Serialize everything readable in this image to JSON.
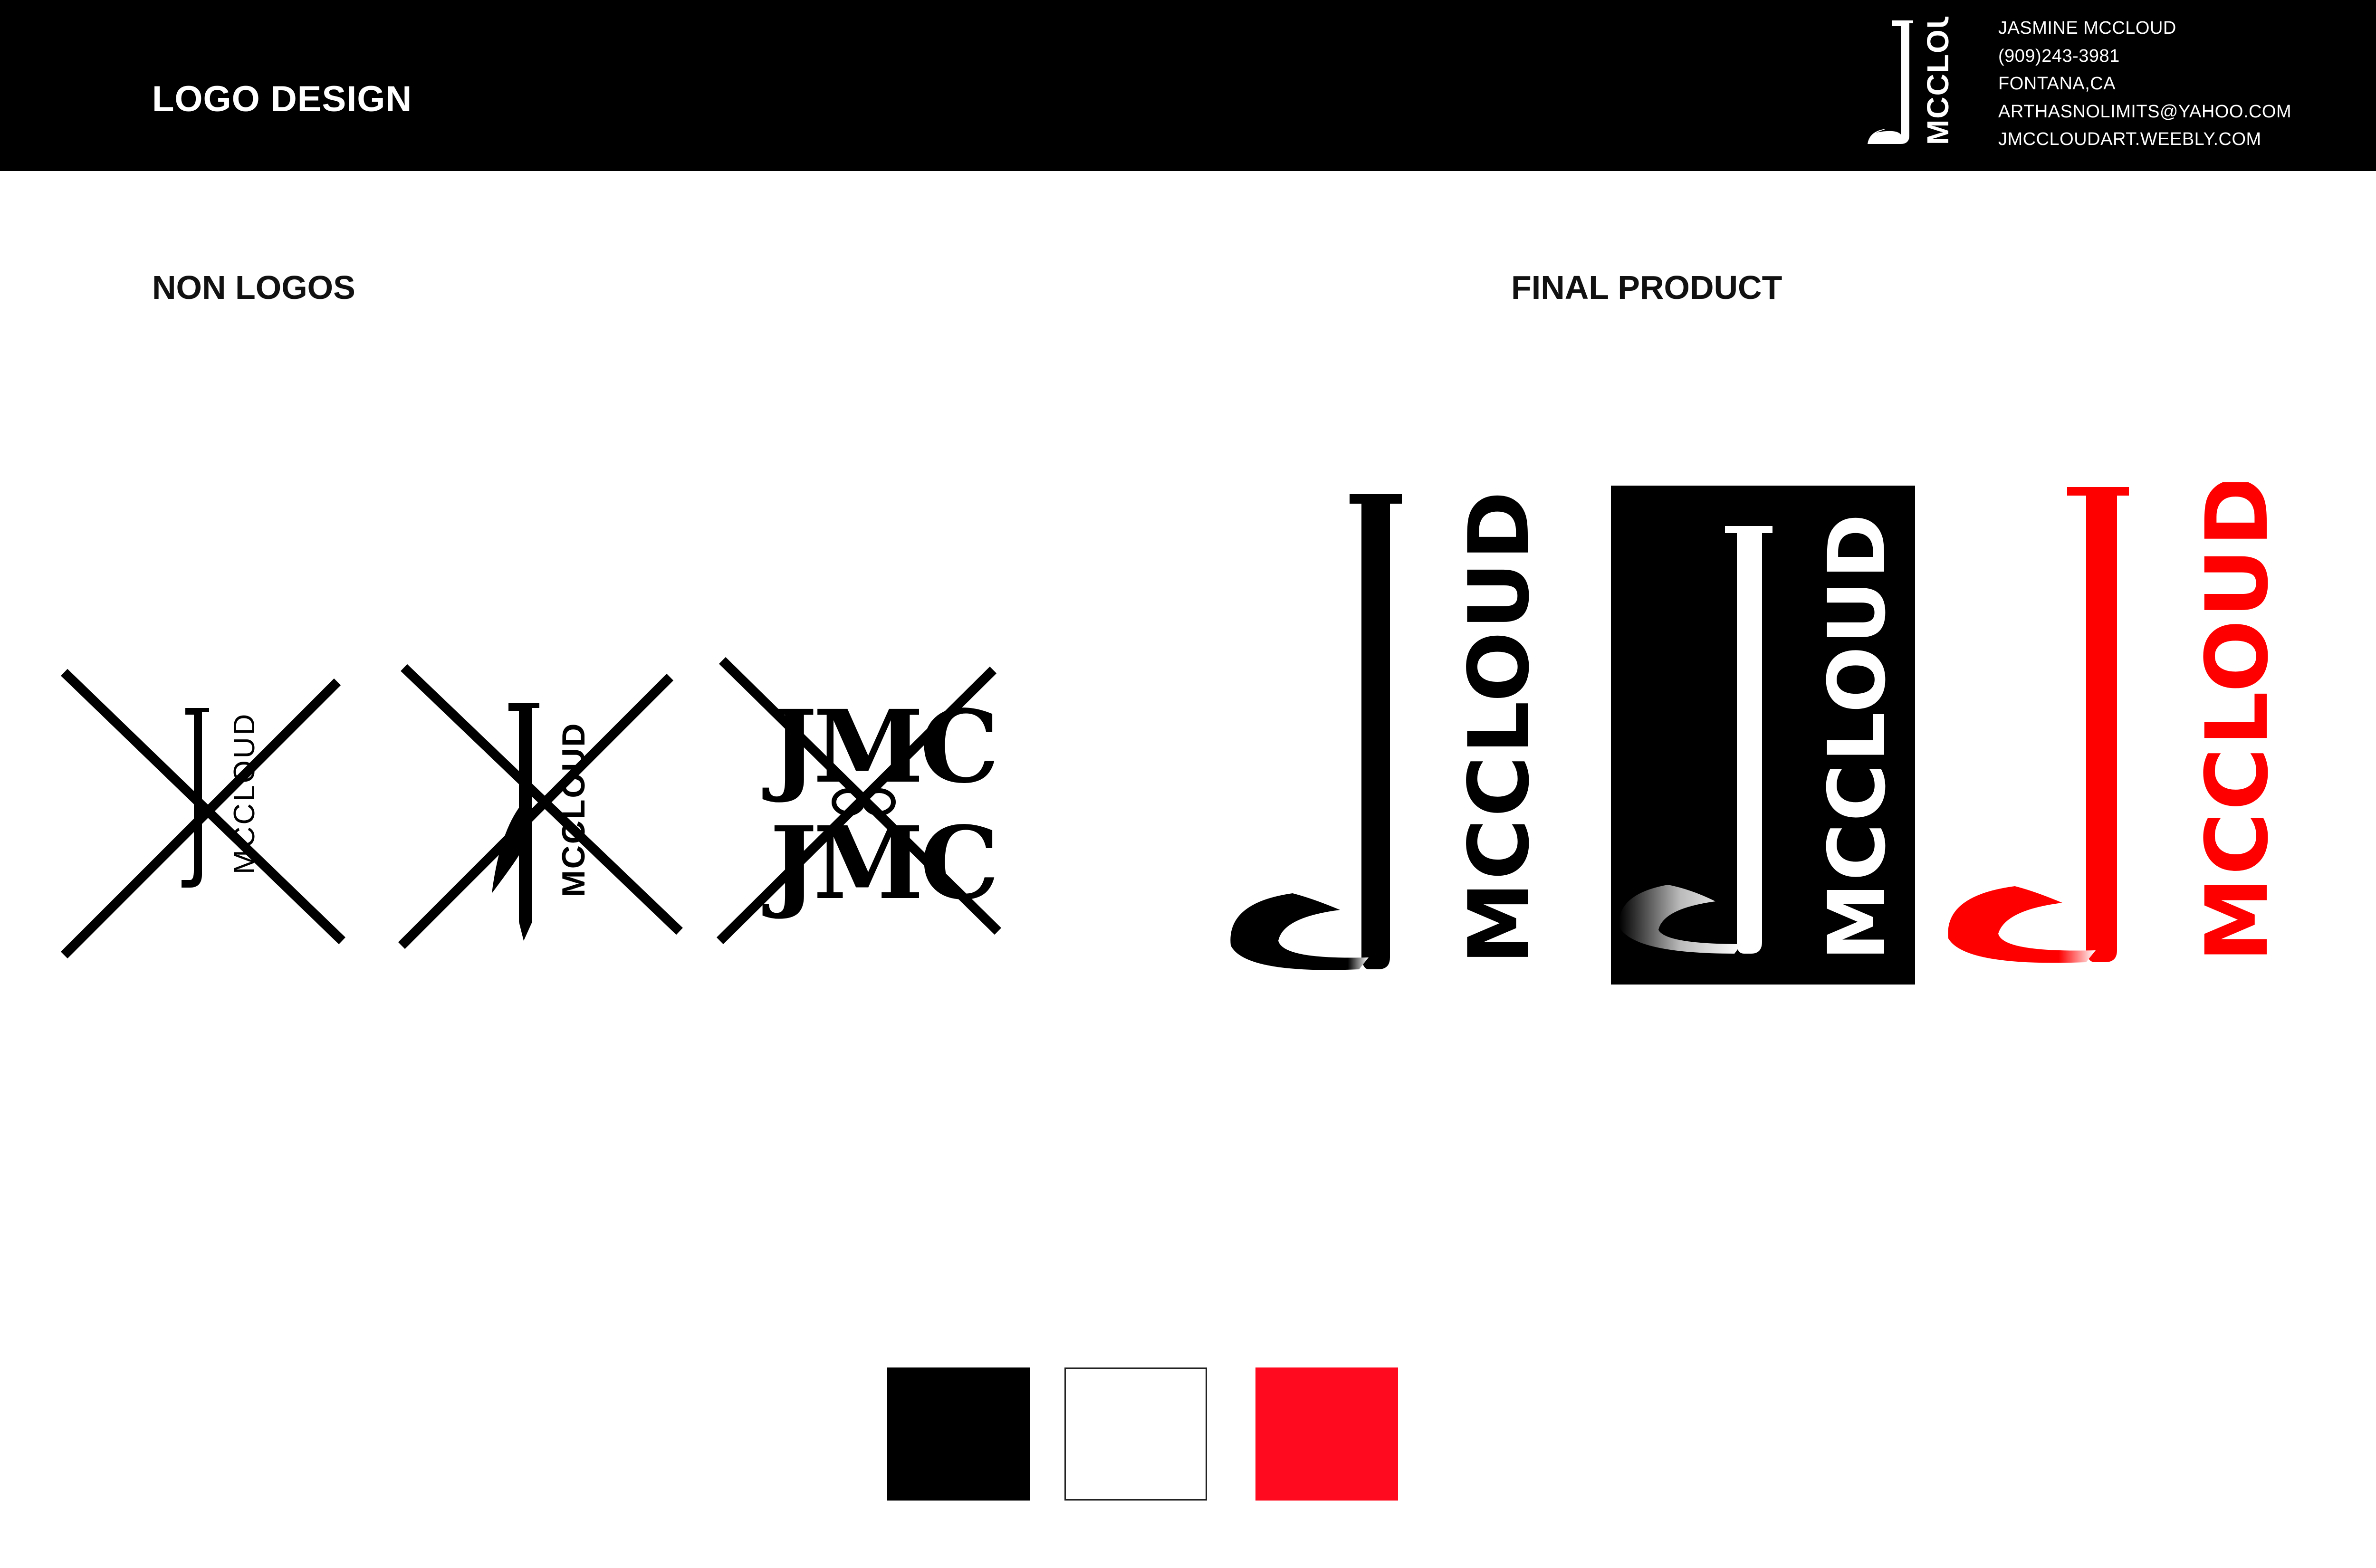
{
  "header": {
    "title": "LOGO DESIGN",
    "logo_text": "MCCLOUD",
    "contact": {
      "name": "JASMINE MCCLOUD",
      "phone": "(909)243-3981",
      "location": "FONTANA,CA",
      "email": "ARTHASNOLIMITS@YAHOO.COM",
      "website": "JMCCLOUDART.WEEBLY.COM"
    }
  },
  "sections": {
    "non_logos": "NON LOGOS",
    "final_product": "FINAL PRODUCT"
  },
  "non_logos": [
    {
      "wordmark": "MCCLOUD",
      "crossed_out": true
    },
    {
      "wordmark": "MCCLOUD",
      "crossed_out": true
    },
    {
      "wordmark": "JMC",
      "crossed_out": true
    }
  ],
  "final_logos": [
    {
      "wordmark": "MCCLOUD",
      "variant": "black-on-white",
      "foreground": "#000000",
      "background": "#ffffff"
    },
    {
      "wordmark": "MCCLOUD",
      "variant": "white-on-black",
      "foreground": "#ffffff",
      "background": "#000000"
    },
    {
      "wordmark": "MCCLOUD",
      "variant": "red-on-white",
      "foreground": "#ff0000",
      "background": "#ffffff"
    }
  ],
  "palette": [
    {
      "name": "black",
      "hex": "#000000"
    },
    {
      "name": "white",
      "hex": "#ffffff"
    },
    {
      "name": "red",
      "hex": "#ff0a1e"
    }
  ]
}
